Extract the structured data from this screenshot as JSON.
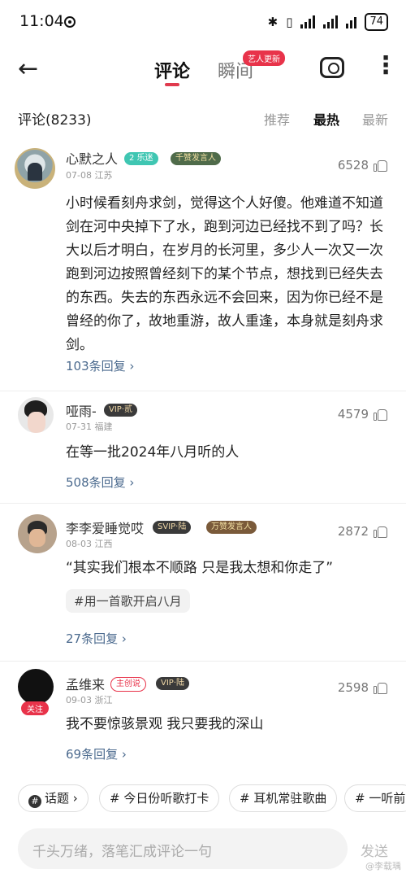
{
  "status": {
    "time": "11:04",
    "battery": "74",
    "bluetooth": "✱",
    "vibrate": "▯"
  },
  "nav": {
    "back_icon": "←",
    "tab_comments": "评论",
    "tab_moments": "瞬间",
    "artist_badge": "艺人更新",
    "more_icon": "⋮"
  },
  "sort": {
    "count": "评论(8233)",
    "recommend": "推荐",
    "hottest": "最热",
    "newest": "最新"
  },
  "comments": [
    {
      "name": "心默之人",
      "level": "2",
      "level_tag": "乐迷",
      "honor": "千赞发言人",
      "date": "07-08 江苏",
      "likes": "6528",
      "text": "小时候看刻舟求剑，觉得这个人好傻。他难道不知道剑在河中央掉下了水，跑到河边已经找不到了吗？长大以后才明白，在岁月的长河里，多少人一次又一次跑到河边按照曾经刻下的某个节点，想找到已经失去的东西。失去的东西永远不会回来，因为你已经不是曾经的你了，故地重游，故人重逢，本身就是刻舟求剑。",
      "replies": "103条回复 ›"
    },
    {
      "name": "哑雨-",
      "vip": "VIP·贰",
      "date": "07-31 福建",
      "likes": "4579",
      "text": "在等一批2024年八月听的人",
      "replies": "508条回复 ›"
    },
    {
      "name": "李李爱睡觉哎",
      "vip": "SVIP·陆",
      "honor": "万赞发言人",
      "date": "08-03 江西",
      "likes": "2872",
      "text": "“其实我们根本不顺路 只是我太想和你走了”",
      "tag": "#用一首歌开启八月",
      "replies": "27条回复 ›"
    },
    {
      "name": "孟维来",
      "role": "主创说",
      "vip": "VIP·陆",
      "follow": "关注",
      "date": "09-03 浙江",
      "likes": "2598",
      "text": "我不要惊骇景观 我只要我的深山",
      "replies": "69条回复 ›"
    }
  ],
  "topics": [
    "话题 ›",
    "# 今日份听歌打卡",
    "# 耳机常驻歌曲",
    "# 一听前"
  ],
  "input": {
    "placeholder": "千头万绪，落笔汇成评论一句",
    "send": "发送"
  },
  "watermark": "@李载瑀",
  "colors": {
    "accent": "#e03a4e",
    "link": "#4b6a8e"
  }
}
